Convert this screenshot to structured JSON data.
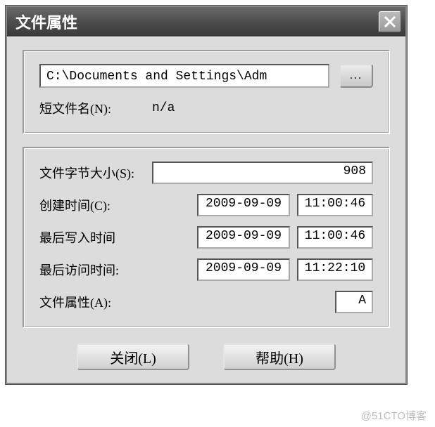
{
  "title": "文件属性",
  "group1": {
    "path": "C:\\Documents and Settings\\Adm",
    "browse_label": "...",
    "short_name_label": "短文件名(N):",
    "short_name_value": "n/a"
  },
  "group2": {
    "size_label": "文件字节大小(S):",
    "size_value": "908",
    "created_label": "创建时间(C):",
    "created_date": "2009-09-09",
    "created_time": "11:00:46",
    "written_label": "最后写入时间",
    "written_date": "2009-09-09",
    "written_time": "11:00:46",
    "accessed_label": "最后访问时间:",
    "accessed_date": "2009-09-09",
    "accessed_time": "11:22:10",
    "attr_label": "文件属性(A):",
    "attr_value": "A"
  },
  "buttons": {
    "close": "关闭(L)",
    "help": "帮助(H)"
  },
  "watermark": "@51CTO博客"
}
